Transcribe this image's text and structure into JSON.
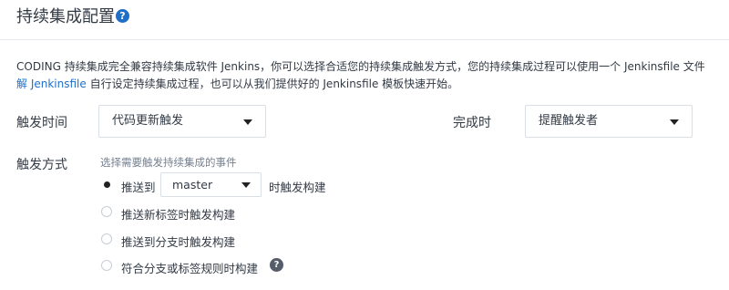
{
  "header": {
    "title": "持续集成配置",
    "help_icon": "question-circle-icon"
  },
  "description": {
    "line1": "CODING 持续集成完全兼容持续集成软件 Jenkins，你可以选择合适您的持续集成触发方式，您的持续集成过程可以使用一个 Jenkinsfile 文件",
    "line2_link": "解 Jenkinsfile",
    "line2_text": " 自行设定持续集成过程，也可以从我们提供好的 Jenkinsfile 模板快速开始。"
  },
  "form": {
    "trigger_time_label": "触发时间",
    "trigger_time_value": "代码更新触发",
    "on_complete_label": "完成时",
    "on_complete_value": "提醒触发者",
    "trigger_mode_label": "触发方式",
    "trigger_mode_hint": "选择需要触发持续集成的事件",
    "options": {
      "push_to_prefix": "推送到",
      "branch_value": "master",
      "push_to_suffix": "时触发构建",
      "push_tag": "推送新标签时触发构建",
      "push_branch": "推送到分支时触发构建",
      "match_rule": "符合分支或标签规则时构建"
    },
    "selected_option": "push_to"
  },
  "colors": {
    "accent": "#1f6fc9",
    "text": "#323a45",
    "muted": "#76808f",
    "border": "#dadfe6"
  }
}
